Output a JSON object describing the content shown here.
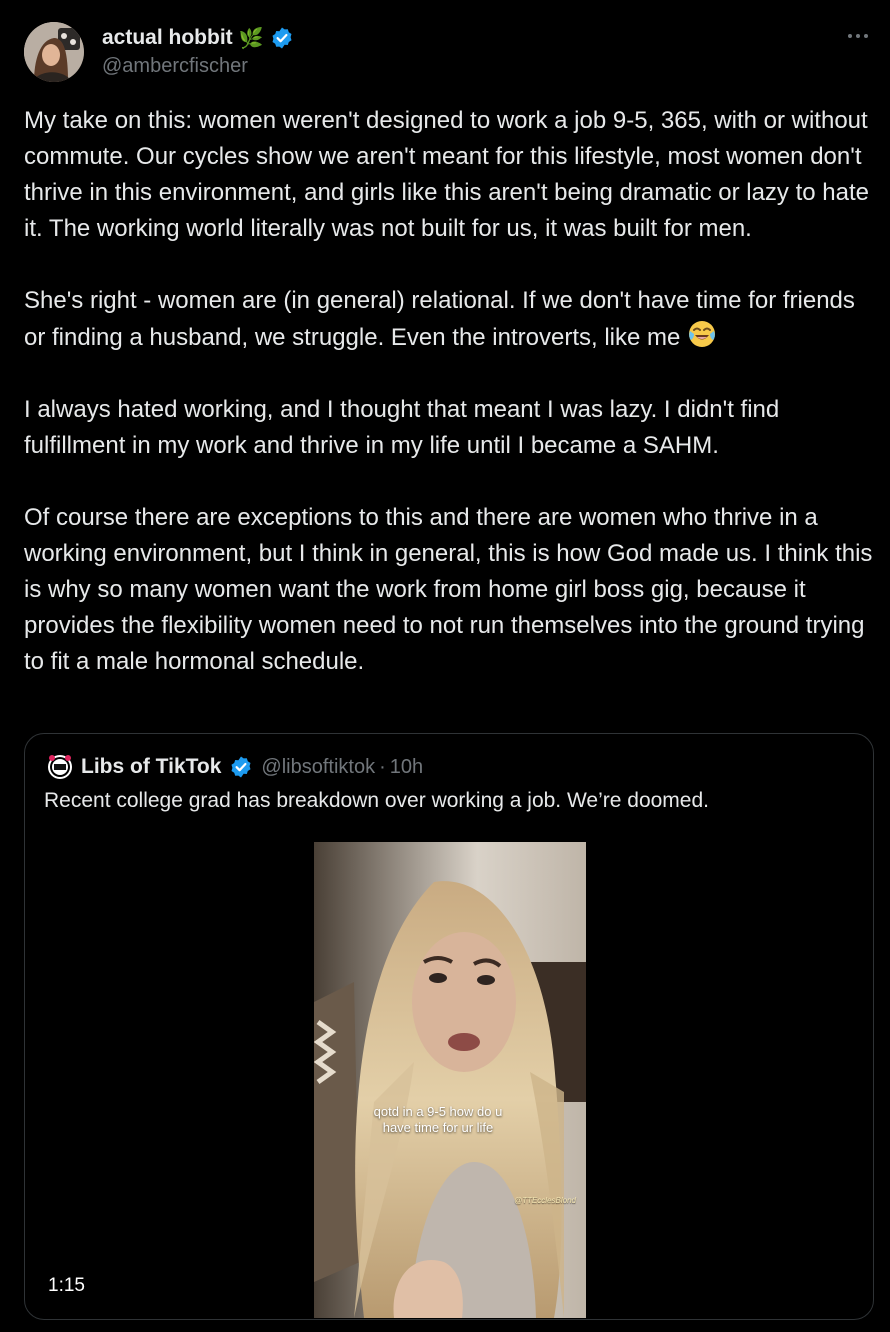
{
  "author": {
    "name": "actual hobbit",
    "name_emoji": "🌿",
    "handle": "@ambercfischer",
    "verified": true
  },
  "icons": {
    "more": "more-options-icon",
    "verified": "verified-badge-icon",
    "laugh": "face-with-tears-of-joy-icon"
  },
  "colors": {
    "background": "#000000",
    "text": "#e7e9ea",
    "secondary": "#71767b",
    "verified": "#1d9bf0",
    "border": "#2f3336"
  },
  "tweet": {
    "paragraphs": [
      "My take on this: women weren't designed to work a job 9-5, 365, with or without commute. Our cycles show we aren't meant for this lifestyle, most women don't thrive in this environment, and girls like this aren't being dramatic or lazy to hate it. The working world literally was not built for us, it was built for men.",
      "She's right - women are (in general) relational. If we don't have time for friends or finding a husband, we struggle. Even the introverts, like me",
      "I always hated working, and I thought that meant I was lazy. I didn't find fulfillment in my work and thrive in my life until I became a SAHM.",
      "Of course there are exceptions to this and there are women who thrive in a working environment, but I think in general, this is how God made us. I think this is why so many women want the work from home girl boss gig, because it provides the flexibility women need to not run themselves into the ground trying to fit a male hormonal schedule."
    ]
  },
  "quote": {
    "name": "Libs of TikTok",
    "handle": "@libsoftiktok",
    "separator": "·",
    "time": "10h",
    "text": "Recent college grad has breakdown over working a job. We’re doomed.",
    "video": {
      "caption_line1": "qotd in a 9-5 how do u",
      "caption_line2": "have time for ur life",
      "watermark": "@TTEcclesBlond",
      "duration": "1:15"
    }
  }
}
